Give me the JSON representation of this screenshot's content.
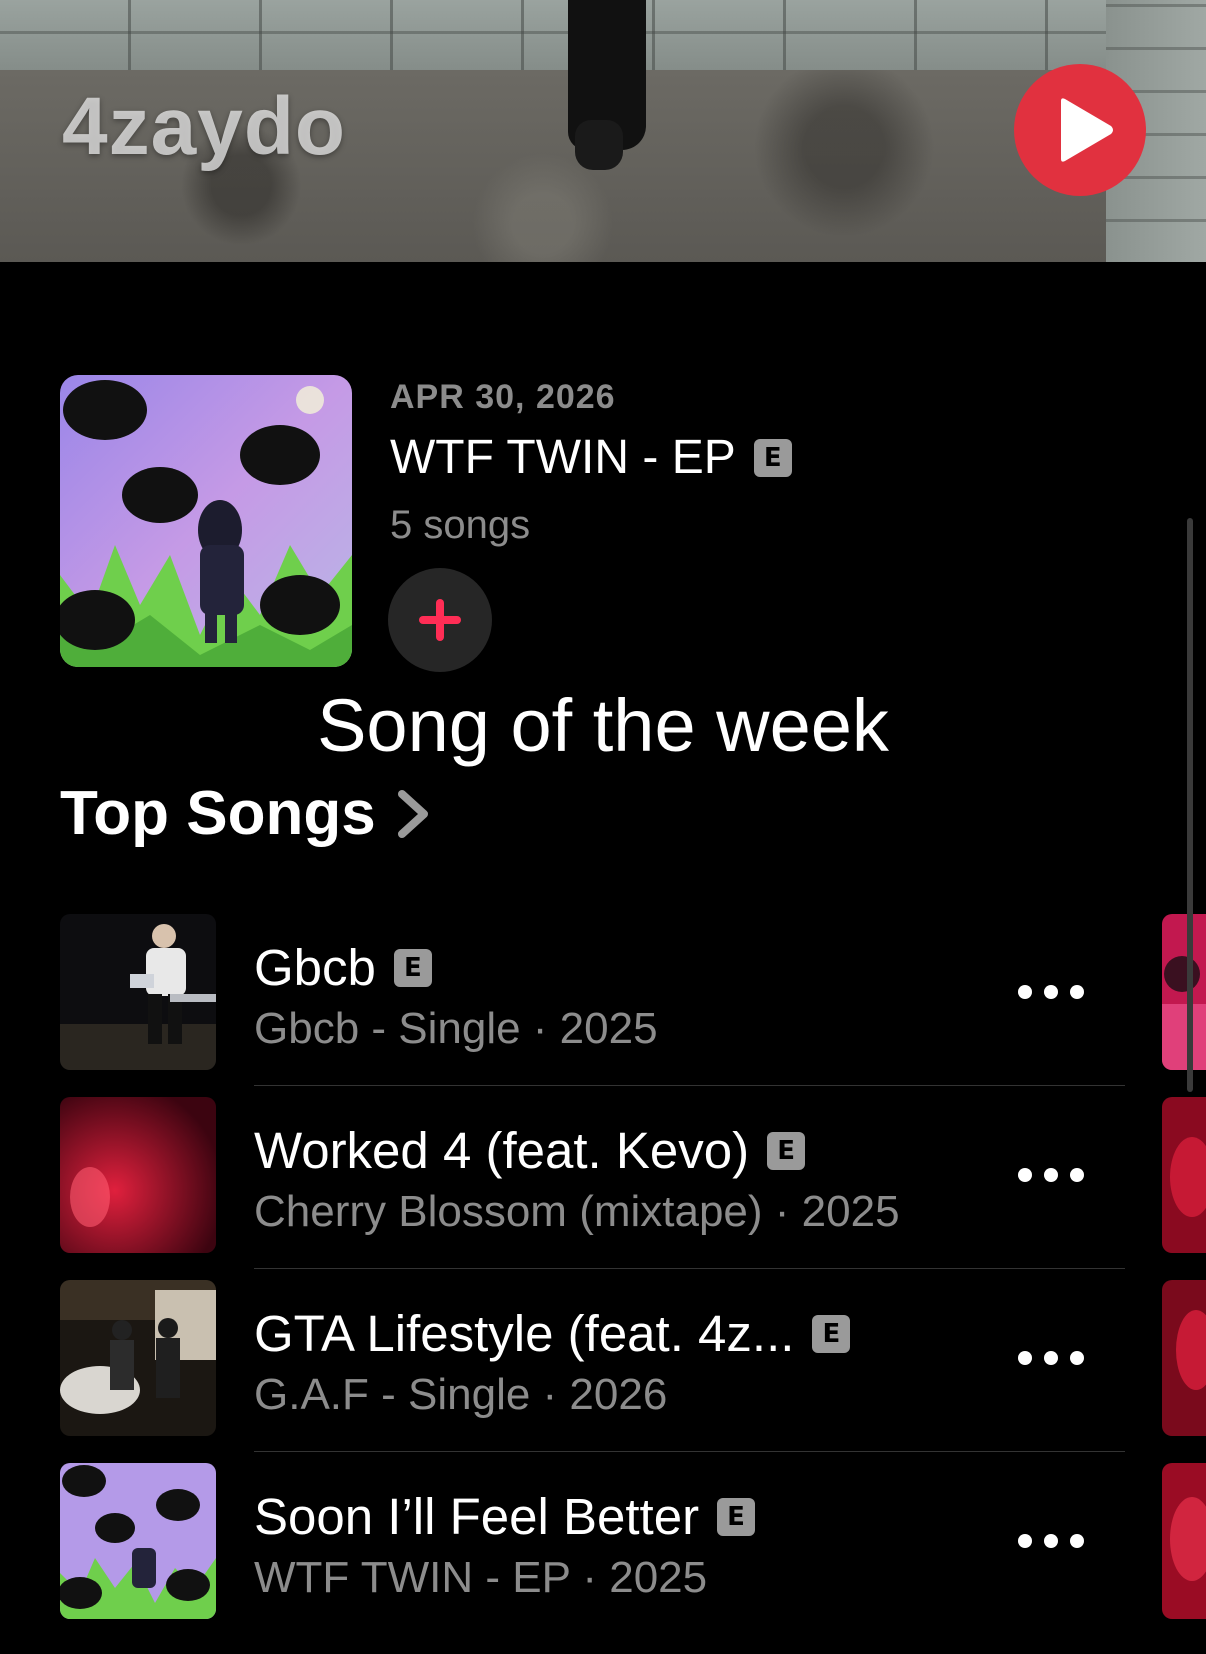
{
  "hero": {
    "artist_name": "4zaydo",
    "play_icon": "play-icon",
    "play_color": "#e1313f"
  },
  "latest_release": {
    "date": "APR 30, 2026",
    "title": "WTF TWIN - EP",
    "explicit": "E",
    "count": "5 songs",
    "add_icon": "plus-icon",
    "accent": "#ff2d55"
  },
  "overlay_text": "Song of the week",
  "top_songs": {
    "heading": "Top Songs",
    "chevron_icon": "chevron-right-icon",
    "items": [
      {
        "title": "Gbcb",
        "explicit": "E",
        "subtitle": "Gbcb - Single · 2025"
      },
      {
        "title": "Worked 4 (feat. Kevo)",
        "explicit": "E",
        "subtitle": "Cherry Blossom (mixtape) · 2025"
      },
      {
        "title": "GTA Lifestyle (feat. 4z...",
        "explicit": "E",
        "subtitle": "G.A.F - Single · 2026"
      },
      {
        "title": "Soon I’ll Feel Better",
        "explicit": "E",
        "subtitle": "WTF TWIN - EP · 2025"
      }
    ]
  }
}
